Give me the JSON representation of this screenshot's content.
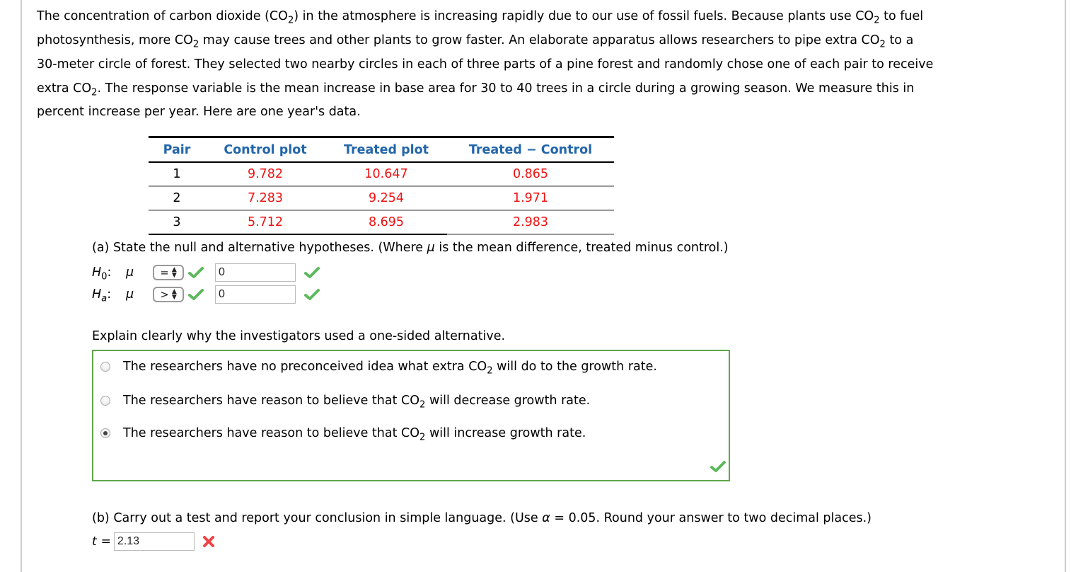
{
  "intro": {
    "line1": [
      "The concentration of carbon dioxide (CO",
      "2",
      ") in the atmosphere is increasing rapidly due to our use of fossil fuels. Because plants use CO",
      "2",
      " to fuel"
    ],
    "line2": [
      "photosynthesis, more CO",
      "2",
      " may cause trees and other plants to grow faster. An elaborate apparatus allows researchers to pipe extra CO",
      "2",
      " to a"
    ],
    "line3": "30-meter circle of forest. They selected two nearby circles in each of three parts of a pine forest and randomly chose one of each pair to receive",
    "line4": [
      "extra CO",
      "2",
      ". The response variable is the mean increase in base area for 30 to 40 trees in a circle during a growing season. We measure this in"
    ],
    "line5": "percent increase per year. Here are one year's data."
  },
  "table": {
    "headers": [
      "Pair",
      "Control plot",
      "Treated plot",
      "Treated − Control"
    ],
    "rows": [
      {
        "pair": "1",
        "control": "9.782",
        "treated": "10.647",
        "diff": "0.865"
      },
      {
        "pair": "2",
        "control": "7.283",
        "treated": "9.254",
        "diff": "1.971"
      },
      {
        "pair": "3",
        "control": "5.712",
        "treated": "8.695",
        "diff": "2.983"
      }
    ]
  },
  "part_a": {
    "prompt_pre": "(a) State the null and alternative hypotheses. (Where ",
    "prompt_mu": "μ",
    "prompt_post": " is the mean difference, treated minus control.)",
    "h0": {
      "label_h": "H",
      "label_sub": "0",
      "colon": ":",
      "mu": "μ",
      "operator": "=",
      "value": "0",
      "operator_correct": true,
      "value_correct": true
    },
    "ha": {
      "label_h": "H",
      "label_sub": "a",
      "colon": ":",
      "mu": "μ",
      "operator": ">",
      "value": "0",
      "operator_correct": true,
      "value_correct": true
    }
  },
  "explain": {
    "prompt": "Explain clearly why the investigators used a one-sided alternative.",
    "options": [
      {
        "pre": "The researchers have no preconceived idea what extra CO",
        "sub": "2",
        "post": " will do to the growth rate.",
        "selected": false
      },
      {
        "pre": "The researchers have reason to believe that CO",
        "sub": "2",
        "post": " will decrease growth rate.",
        "selected": false
      },
      {
        "pre": "The researchers have reason to believe that CO",
        "sub": "2",
        "post": " will increase growth rate.",
        "selected": true
      }
    ],
    "status": "correct"
  },
  "part_b": {
    "prompt_pre": "(b) Carry out a test and report your conclusion in simple language. (Use ",
    "alpha": "α",
    "prompt_post": " = 0.05. Round your answer to two decimal places.)",
    "t_label": "t",
    "eq": "=",
    "t_value": "2.13",
    "status": "incorrect"
  },
  "colors": {
    "header_blue": "#2266aa",
    "value_red": "#ee1111",
    "correct_green": "#5fa64a",
    "incorrect_red": "#ee4444"
  }
}
